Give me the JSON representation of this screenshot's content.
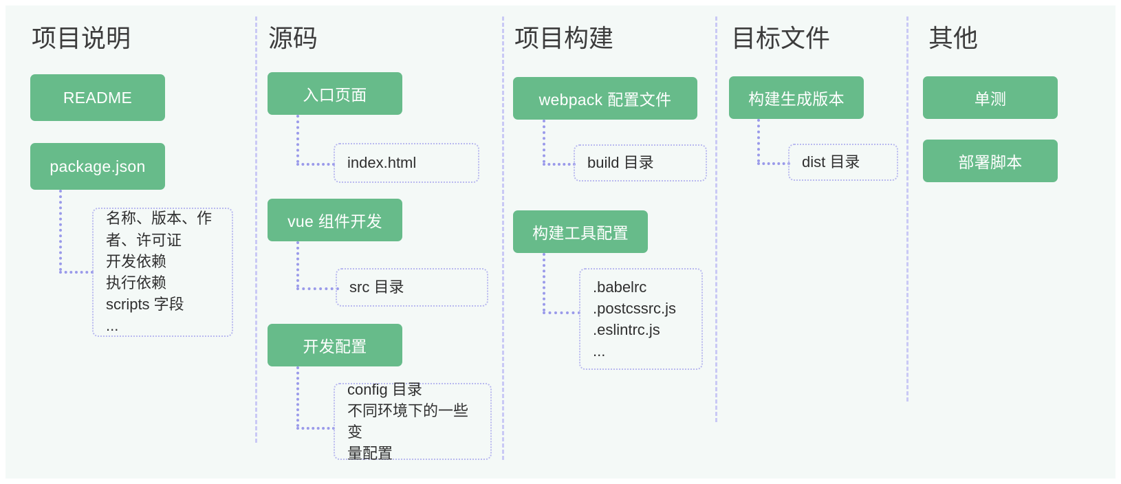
{
  "diagram": {
    "title_bg_color": "#f4f9f7",
    "node_color": "#67bb8a",
    "detail_border_color": "#b8b8ef",
    "connector_color": "#9a9aea",
    "divider_color": "#c9c9f5",
    "columns": [
      {
        "id": "project-description",
        "title": "项目说明",
        "nodes": [
          {
            "id": "readme",
            "label": "README"
          },
          {
            "id": "package-json",
            "label": "package.json"
          }
        ],
        "details": [
          {
            "id": "package-json-detail",
            "lines": [
              "名称、版本、作",
              "者、许可证",
              "开发依赖",
              "执行依赖",
              "scripts 字段",
              "..."
            ]
          }
        ]
      },
      {
        "id": "source-code",
        "title": "源码",
        "nodes": [
          {
            "id": "entry-page",
            "label": "入口页面"
          },
          {
            "id": "vue-component-dev",
            "label": "vue 组件开发"
          },
          {
            "id": "dev-config",
            "label": "开发配置"
          }
        ],
        "details": [
          {
            "id": "index-html-detail",
            "lines": [
              "index.html"
            ]
          },
          {
            "id": "src-dir-detail",
            "lines": [
              "src 目录"
            ]
          },
          {
            "id": "config-dir-detail",
            "lines": [
              "config 目录",
              "不同环境下的一些变",
              "量配置"
            ]
          }
        ]
      },
      {
        "id": "project-build",
        "title": "项目构建",
        "nodes": [
          {
            "id": "webpack-config-files",
            "label": "webpack 配置文件"
          },
          {
            "id": "build-tool-config",
            "label": "构建工具配置"
          }
        ],
        "details": [
          {
            "id": "build-dir-detail",
            "lines": [
              "build 目录"
            ]
          },
          {
            "id": "build-tool-detail",
            "lines": [
              ".babelrc",
              ".postcssrc.js",
              ".eslintrc.js",
              "..."
            ]
          }
        ]
      },
      {
        "id": "target-files",
        "title": "目标文件",
        "nodes": [
          {
            "id": "build-output-version",
            "label": "构建生成版本"
          }
        ],
        "details": [
          {
            "id": "dist-dir-detail",
            "lines": [
              "dist 目录"
            ]
          }
        ]
      },
      {
        "id": "others",
        "title": "其他",
        "nodes": [
          {
            "id": "unit-test",
            "label": "单测"
          },
          {
            "id": "deploy-script",
            "label": "部署脚本"
          }
        ],
        "details": []
      }
    ]
  }
}
